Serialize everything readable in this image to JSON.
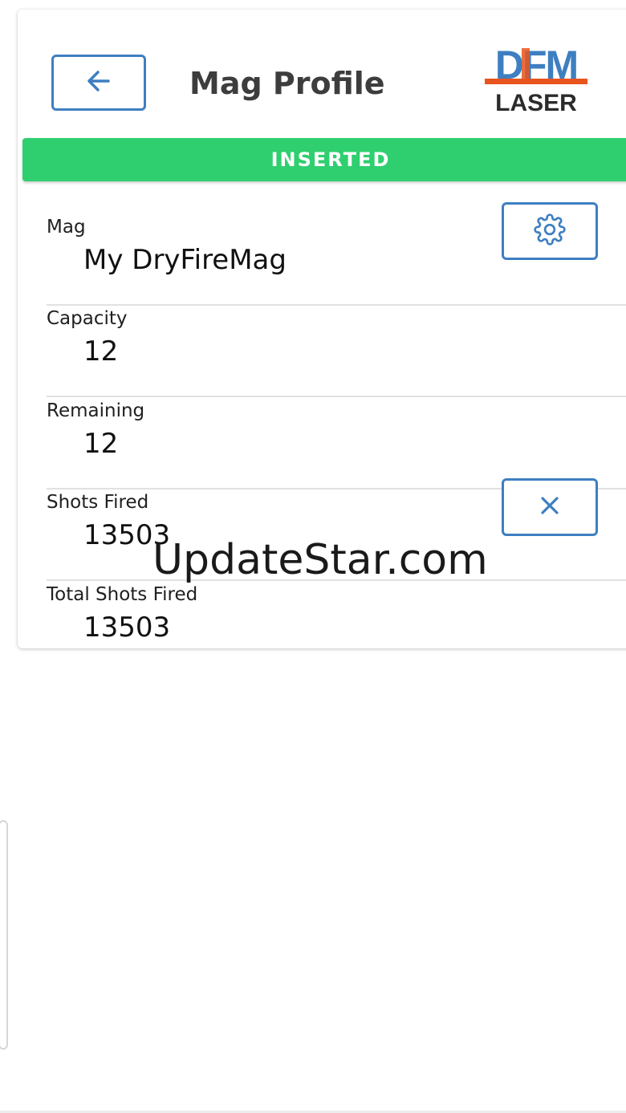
{
  "header": {
    "title": "Mag Profile",
    "logo_top": "DFM",
    "logo_bottom": "LASER"
  },
  "status": {
    "label": "INSERTED",
    "color": "#2fcf6f"
  },
  "fields": {
    "mag": {
      "label": "Mag",
      "value": "My DryFireMag"
    },
    "capacity": {
      "label": "Capacity",
      "value": "12"
    },
    "remaining": {
      "label": "Remaining",
      "value": "12"
    },
    "shots_fired": {
      "label": "Shots Fired",
      "value": "13503"
    },
    "total_shots_fired": {
      "label": "Total Shots Fired",
      "value": "13503"
    }
  },
  "icons": {
    "back": "arrow-left-icon",
    "settings": "gear-icon",
    "reset": "close-icon"
  },
  "colors": {
    "accent": "#3e7fc1",
    "logo_blue": "#3e7fc1",
    "logo_orange": "#e8541e",
    "logo_dark": "#2b2b2b"
  },
  "watermark": "UpdateStar.com"
}
